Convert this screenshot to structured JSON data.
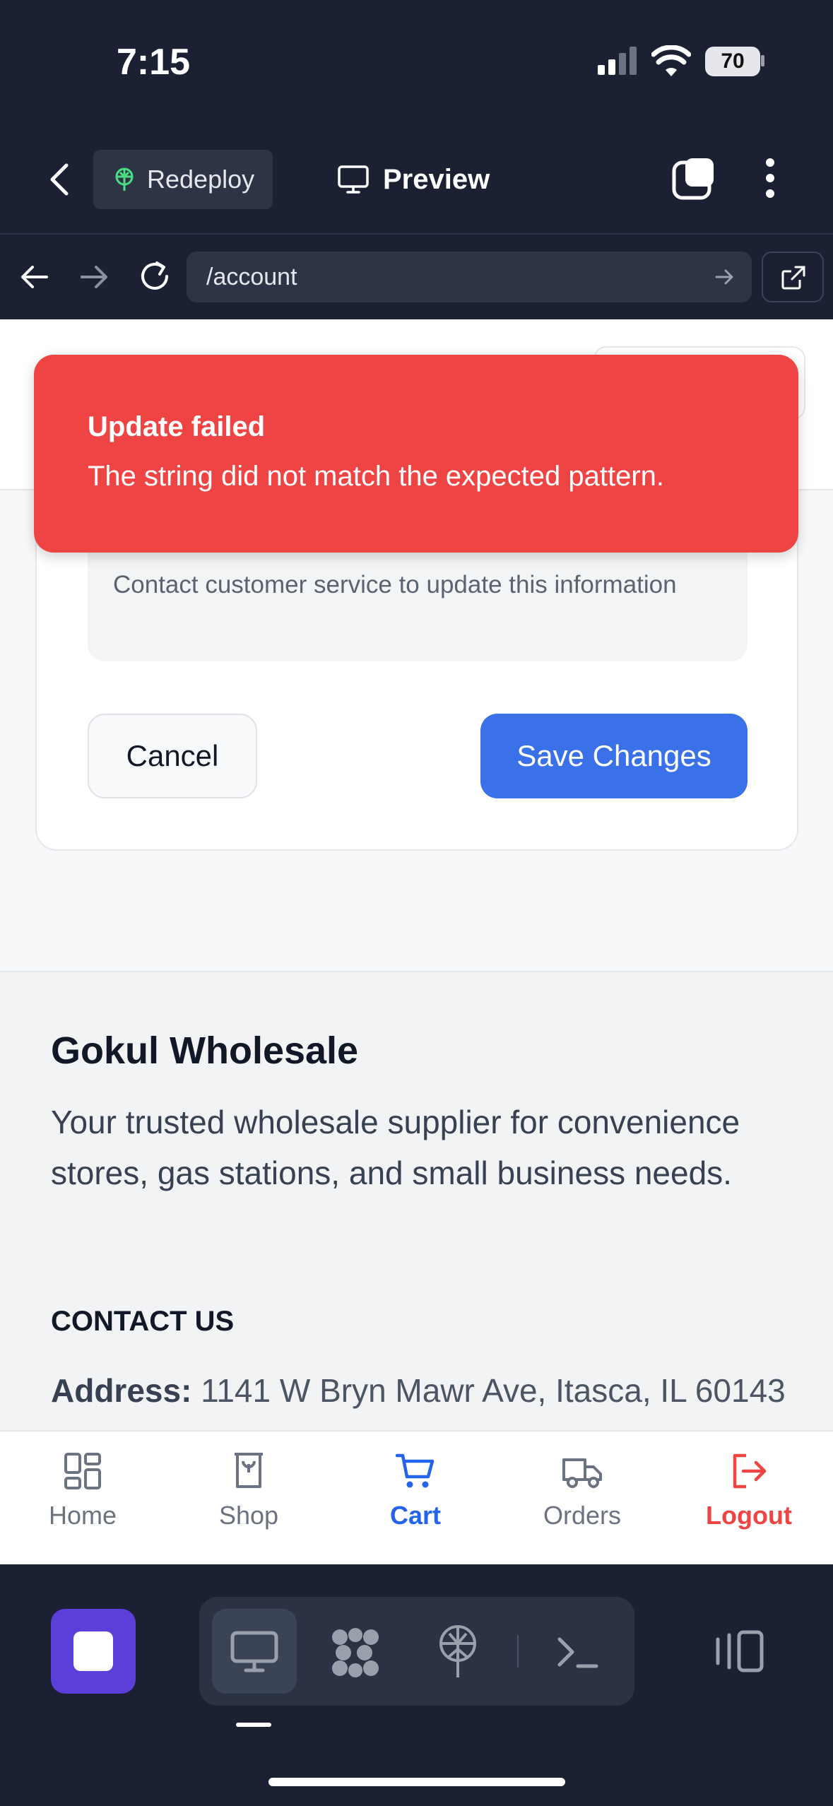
{
  "status_bar": {
    "time": "7:15",
    "battery": "70"
  },
  "toolbar": {
    "redeploy_label": "Redeploy",
    "preview_label": "Preview"
  },
  "url_bar": {
    "path": "/account"
  },
  "toast": {
    "title": "Update failed",
    "message": "The string did not match the expected pattern."
  },
  "form": {
    "info_text": "Contact customer service to update this information",
    "cancel_label": "Cancel",
    "save_label": "Save Changes"
  },
  "footer": {
    "brand": "Gokul Wholesale",
    "tagline": "Your trusted wholesale supplier for convenience stores, gas stations, and small business needs.",
    "contact_heading": "CONTACT US",
    "address_label": "Address:",
    "address_value": "1141 W Bryn Mawr Ave, Itasca, IL 60143"
  },
  "tabs": [
    {
      "label": "Home",
      "icon": "grid-icon"
    },
    {
      "label": "Shop",
      "icon": "bag-icon"
    },
    {
      "label": "Cart",
      "icon": "cart-icon",
      "active": true
    },
    {
      "label": "Orders",
      "icon": "truck-icon"
    },
    {
      "label": "Logout",
      "icon": "logout-icon"
    }
  ],
  "colors": {
    "accent": "#3b71e8",
    "toast": "#ef4444",
    "chrome": "#1b2133",
    "stop": "#5b3fd8"
  }
}
